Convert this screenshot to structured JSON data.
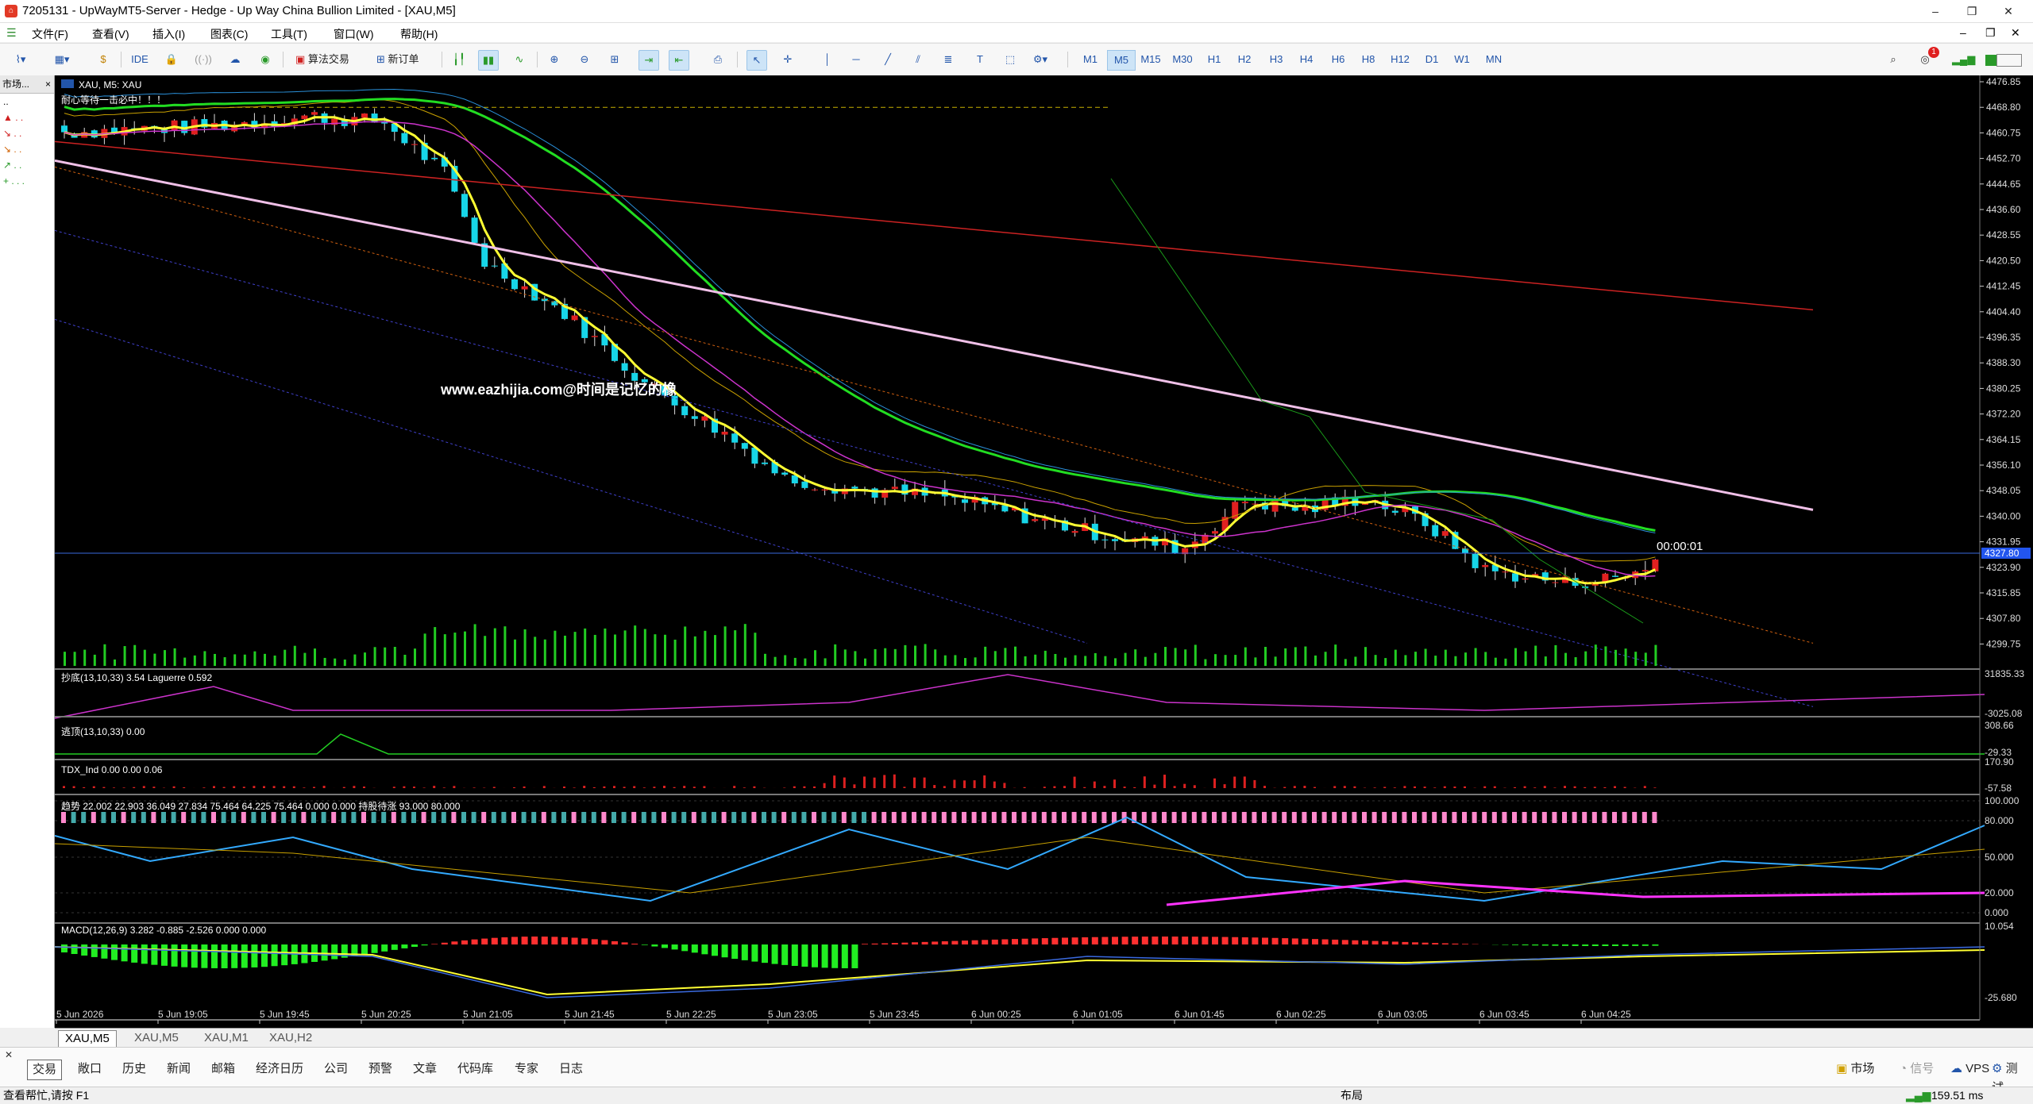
{
  "window": {
    "title": "7205131 - UpWayMT5-Server - Hedge - Up Way China Bullion Limited - [XAU,M5]",
    "min": "–",
    "restore": "❐",
    "close": "✕",
    "child_min": "–",
    "child_restore": "❐",
    "child_close": "✕"
  },
  "menu": [
    "文件(F)",
    "查看(V)",
    "插入(I)",
    "图表(C)",
    "工具(T)",
    "窗口(W)",
    "帮助(H)"
  ],
  "toolbar": {
    "ide": "IDE",
    "algo": "算法交易",
    "new_order": "新订单",
    "timeframes": [
      "M1",
      "M5",
      "M15",
      "M30",
      "H1",
      "H2",
      "H3",
      "H4",
      "H6",
      "H8",
      "H12",
      "D1",
      "W1",
      "MN"
    ],
    "active_timeframe": "M5",
    "notif_count": "1"
  },
  "market_watch": {
    "title": "市场...",
    "close": "×",
    "rows": [
      "..",
      "▲ . .",
      "↘ . .",
      "↘ . .",
      "↗ . .",
      "+ . . ."
    ]
  },
  "chart": {
    "symbol_label": "XAU, M5:  XAU",
    "comment": "耐心等待一击必中！！！",
    "watermark": "www.eazhijia.com@时间是记忆的橡",
    "countdown": "00:00:01",
    "current_price": "4327.80",
    "price_ticks": [
      "4476.85",
      "4468.80",
      "4460.75",
      "4452.70",
      "4444.65",
      "4436.60",
      "4428.55",
      "4420.50",
      "4412.45",
      "4404.40",
      "4396.35",
      "4388.30",
      "4380.25",
      "4372.20",
      "4364.15",
      "4356.10",
      "4348.05",
      "4340.00",
      "4331.95",
      "4323.90",
      "4315.85",
      "4307.80",
      "4299.75"
    ],
    "time_ticks": [
      "5 Jun 2026",
      "5 Jun 19:05",
      "5 Jun 19:45",
      "5 Jun 20:25",
      "5 Jun 21:05",
      "5 Jun 21:45",
      "5 Jun 22:25",
      "5 Jun 23:05",
      "5 Jun 23:45",
      "6 Jun 00:25",
      "6 Jun 01:05",
      "6 Jun 01:45",
      "6 Jun 02:25",
      "6 Jun 03:05",
      "6 Jun 03:45",
      "6 Jun 04:25"
    ]
  },
  "subwindows": {
    "ind1_label": "抄底(13,10,33) 3.54 Laguerre 0.592",
    "ind1_ticks": [
      "31835.33",
      "-3025.08"
    ],
    "ind2_label": "逃顶(13,10,33) 0.00",
    "ind2_ticks": [
      "308.66",
      "-29.33"
    ],
    "ind3_label": "TDX_Ind 0.00 0.00 0.06",
    "ind3_ticks": [
      "170.90",
      "-57.58"
    ],
    "ind4_label": "趋势 22.002 22.903 36.049 27.834 75.464 64.225 75.464 0.000 0.000 持股待涨 93.000 80.000",
    "ind4_ticks": [
      "100.000",
      "80.000",
      "50.000",
      "20.000",
      "0.000"
    ],
    "macd_label": "MACD(12,26,9) 3.282 -0.885 -2.526 0.000 0.000",
    "macd_ticks": [
      "10.054",
      "-25.680"
    ]
  },
  "chart_tabs": [
    "XAU,M5",
    "XAU,M5",
    "XAU,M1",
    "XAU,H2"
  ],
  "toolbox_tabs": [
    "交易",
    "敞口",
    "历史",
    "新闻",
    "邮箱",
    "经济日历",
    "公司",
    "预警",
    "文章",
    "代码库",
    "专家",
    "日志"
  ],
  "toolbox_right": {
    "market": "市场",
    "signals": "信号",
    "vps": "VPS",
    "test": "测试"
  },
  "status": {
    "help": "查看帮忙,请按 F1",
    "layout": "布局",
    "ping": "159.51 ms"
  },
  "colors": {
    "bull": "#e02020",
    "bear": "#17d5e8",
    "ma_green": "#22dd22",
    "ma_yellow": "#ffff33",
    "ma_pink": "#f0c0e8",
    "ma_red": "#cc2222"
  }
}
